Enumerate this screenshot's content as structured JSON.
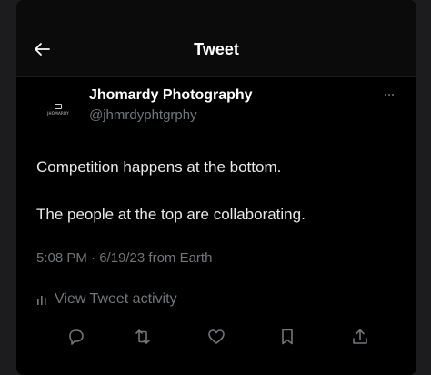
{
  "header": {
    "title": "Tweet"
  },
  "author": {
    "display_name": "Jhomardy Photography",
    "handle": "@jhmrdyphtgrphy",
    "avatar_text": "JHOMARDY"
  },
  "tweet": {
    "line1": "Competition happens at the bottom.",
    "line2": "The people at the top are collaborating.",
    "meta": "5:08 PM · 6/19/23 from Earth"
  },
  "activity": {
    "label": "View Tweet activity"
  },
  "icons": {
    "back": "arrow-left-icon",
    "more": "more-dots-icon",
    "activity": "bar-chart-icon",
    "reply": "reply-icon",
    "retweet": "retweet-icon",
    "like": "heart-icon",
    "bookmark": "bookmark-icon",
    "share": "share-icon"
  },
  "colors": {
    "background": "#000000",
    "primary_text": "#e7e9ea",
    "secondary_text": "#71767b",
    "divider": "#2f3336"
  }
}
